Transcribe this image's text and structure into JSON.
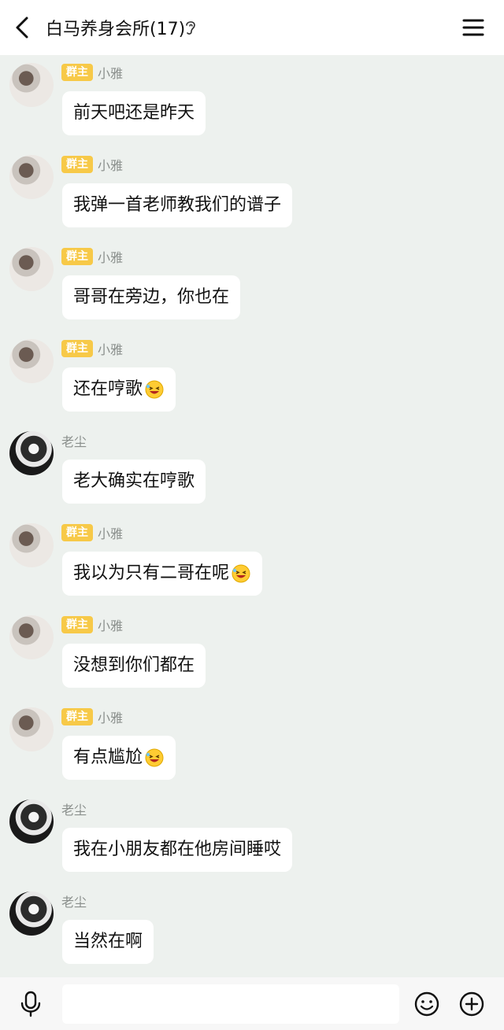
{
  "header": {
    "title": "白马养身会所(17)",
    "icons": [
      "back-arrow-icon",
      "ear-icon",
      "menu-icon"
    ]
  },
  "colors": {
    "badge": "#f7c948",
    "chat_background": "#edf1ee",
    "bubble": "#ffffff"
  },
  "messages": [
    {
      "sender": "小雅",
      "badge": "群主",
      "text": "前天吧还是昨天",
      "emoji": ""
    },
    {
      "sender": "小雅",
      "badge": "群主",
      "text": "我弹一首老师教我们的谱子",
      "emoji": ""
    },
    {
      "sender": "小雅",
      "badge": "群主",
      "text": "哥哥在旁边，你也在",
      "emoji": ""
    },
    {
      "sender": "小雅",
      "badge": "群主",
      "text": "还在哼歌",
      "emoji": "laughing-face-emoji"
    },
    {
      "sender": "老尘",
      "badge": "",
      "text": "老大确实在哼歌",
      "emoji": ""
    },
    {
      "sender": "小雅",
      "badge": "群主",
      "text": "我以为只有二哥在呢",
      "emoji": "laughing-face-emoji"
    },
    {
      "sender": "小雅",
      "badge": "群主",
      "text": "没想到你们都在",
      "emoji": ""
    },
    {
      "sender": "小雅",
      "badge": "群主",
      "text": "有点尴尬",
      "emoji": "laughing-face-emoji"
    },
    {
      "sender": "老尘",
      "badge": "",
      "text": "我在小朋友都在他房间睡哎",
      "emoji": ""
    },
    {
      "sender": "老尘",
      "badge": "",
      "text": "当然在啊",
      "emoji": ""
    }
  ],
  "input_bar": {
    "value": "",
    "icons": [
      "microphone-icon",
      "emoji-icon",
      "plus-icon"
    ]
  }
}
